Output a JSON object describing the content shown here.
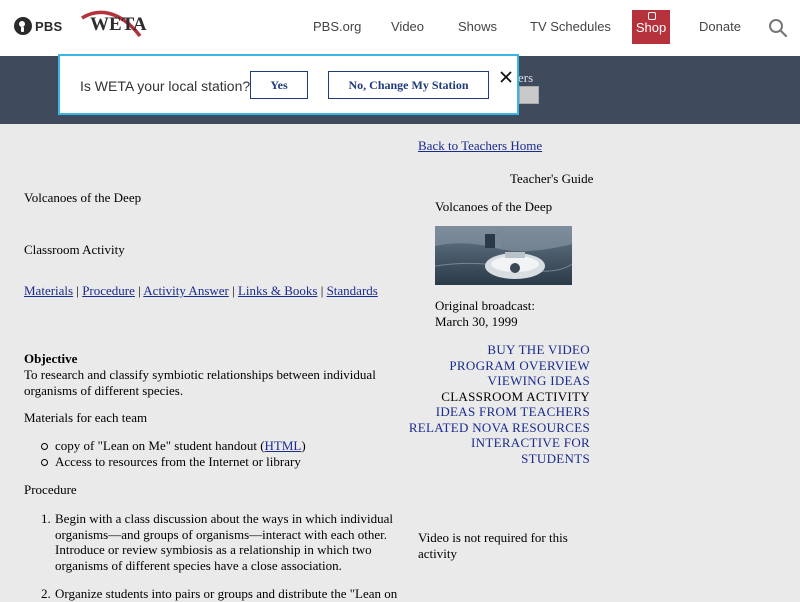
{
  "header": {
    "pbs_logo_text": "PBS",
    "station_logo_text": "WETA",
    "nav": [
      {
        "label": "PBS.org"
      },
      {
        "label": "Video"
      },
      {
        "label": "Shows"
      },
      {
        "label": "TV Schedules"
      },
      {
        "label": "Shop"
      },
      {
        "label": "Donate"
      }
    ],
    "shop_color": "#b5323c"
  },
  "band": {
    "partial_text": "ers",
    "color": "#3f4a5c"
  },
  "popup": {
    "question": "Is WETA your local station?",
    "yes_label": "Yes",
    "change_label": "No, Change My Station",
    "close_glyph": "×",
    "border_color": "#3bb5e5"
  },
  "left": {
    "title": "Volcanoes of the Deep",
    "subtitle": "Classroom Activity",
    "jump_links": [
      "Materials",
      "Procedure",
      "Activity Answer",
      "Links & Books",
      "Standards"
    ],
    "separator": " | ",
    "objective_heading": "Objective",
    "objective_lines": [
      "To research and classify symbiotic relationships between individual",
      "organisms of different species."
    ],
    "materials_heading": "Materials for each team",
    "materials": [
      {
        "before": "copy of \"Lean on Me\" student handout (",
        "link": "HTML",
        "after": ")"
      },
      {
        "text": "Access to resources from the Internet or library"
      }
    ],
    "procedure_heading": "Procedure",
    "procedure": [
      {
        "num": "1.",
        "lines": [
          "Begin with a class discussion about the ways in which individual",
          "organisms—and groups of organisms—interact with each other.",
          "Introduce or review symbiosis as a relationship in which two",
          "organisms of different species have a close association."
        ]
      },
      {
        "num": "2.",
        "lines": [
          "Organize students into pairs or groups and distribute the \"Lean on"
        ]
      }
    ]
  },
  "right": {
    "back_link": "Back to Teachers Home",
    "guide_label": "Teacher's Guide",
    "program_title": "Volcanoes of the Deep",
    "broadcast_label": "Original broadcast:",
    "broadcast_date": "March 30, 1999",
    "nav": [
      {
        "label": "BUY THE VIDEO",
        "current": false
      },
      {
        "label": "PROGRAM OVERVIEW",
        "current": false
      },
      {
        "label": "VIEWING IDEAS",
        "current": false
      },
      {
        "label": "CLASSROOM ACTIVITY",
        "current": true
      },
      {
        "label": "IDEAS FROM TEACHERS",
        "current": false
      },
      {
        "label": "RELATED NOVA RESOURCES",
        "current": false
      },
      {
        "label": "INTERACTIVE FOR",
        "current": false
      },
      {
        "label": "STUDENTS",
        "current": false
      }
    ],
    "video_note_lines": [
      "Video is not required for this",
      "activity"
    ]
  },
  "colors": {
    "link": "#1a2b8c",
    "page_bg": "#eaeaea"
  }
}
